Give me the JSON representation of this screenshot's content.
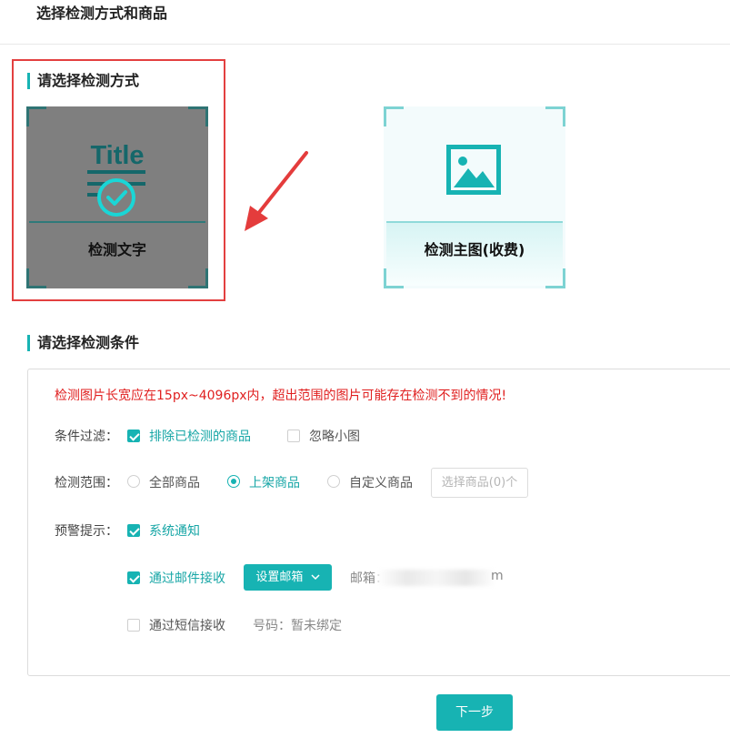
{
  "page": {
    "title": "选择检测方式和商品"
  },
  "method_section": {
    "title": "请选择检测方式",
    "cards": [
      {
        "label": "检测文字",
        "icon": "title-check-icon",
        "icon_text": "Title",
        "selected": true
      },
      {
        "label": "检测主图(收费)",
        "icon": "image-icon",
        "selected": false
      }
    ]
  },
  "conditions_section": {
    "title": "请选择检测条件",
    "warning": "检测图片长宽应在15px~4096px内，超出范围的图片可能存在检测不到的情况!",
    "filter": {
      "label": "条件过滤：",
      "options": [
        {
          "label": "排除已检测的商品",
          "checked": true
        },
        {
          "label": "忽略小图",
          "checked": false
        }
      ]
    },
    "scope": {
      "label": "检测范围：",
      "options": [
        {
          "label": "全部商品",
          "checked": false
        },
        {
          "label": "上架商品",
          "checked": true
        },
        {
          "label": "自定义商品",
          "checked": false
        }
      ],
      "select_button": "选择商品(0)个"
    },
    "alert": {
      "label": "预警提示：",
      "system": {
        "label": "系统通知",
        "checked": true
      },
      "email": {
        "label": "通过邮件接收",
        "checked": true,
        "button": "设置邮箱",
        "info_label": "邮箱：",
        "info_tail": "m"
      },
      "sms": {
        "label": "通过短信接收",
        "checked": false,
        "info": "号码：暂未绑定"
      }
    }
  },
  "footer": {
    "next": "下一步"
  },
  "colors": {
    "accent": "#17b3b3",
    "warning": "#e02020",
    "highlight": "#e34040"
  }
}
